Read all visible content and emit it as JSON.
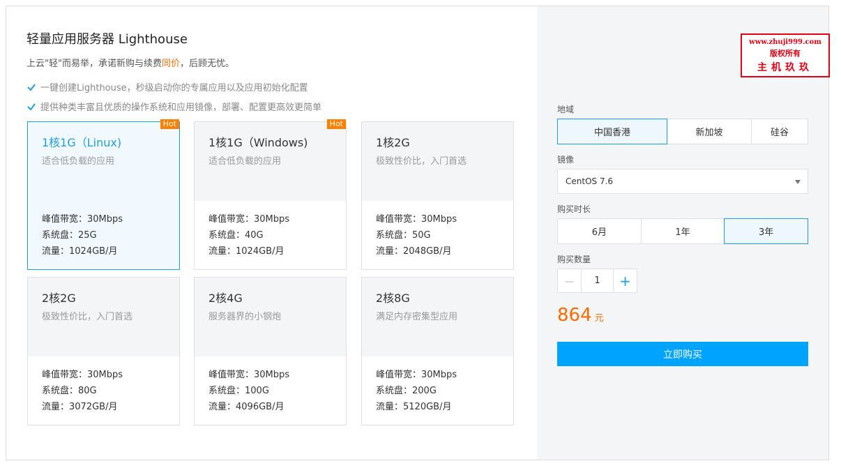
{
  "header": {
    "title": "轻量应用服务器 Lighthouse",
    "subtitle_prefix": "上云\"轻\"而易举，承诺新购与续费",
    "subtitle_highlight": "同价",
    "subtitle_suffix": "，后顾无忧。",
    "features": [
      "一键创建Lighthouse，秒级启动你的专属应用以及应用初始化配置",
      "提供种类丰富且优质的操作系统和应用镜像，部署、配置更高效更简单"
    ]
  },
  "plans": [
    {
      "name": "1核1G（Linux)",
      "desc": "适合低负载的应用",
      "hot": "Hot",
      "bandwidth": "峰值带宽：30Mbps",
      "disk": "系统盘：25G",
      "traffic": "流量：1024GB/月",
      "selected": true
    },
    {
      "name": "1核1G（Windows)",
      "desc": "适合低负载的应用",
      "hot": "Hot",
      "bandwidth": "峰值带宽：30Mbps",
      "disk": "系统盘：40G",
      "traffic": "流量：1024GB/月",
      "selected": false
    },
    {
      "name": "1核2G",
      "desc": "极致性价比，入门首选",
      "hot": "",
      "bandwidth": "峰值带宽：30Mbps",
      "disk": "系统盘：50G",
      "traffic": "流量：2048GB/月",
      "selected": false
    },
    {
      "name": "2核2G",
      "desc": "极致性价比，入门首选",
      "hot": "",
      "bandwidth": "峰值带宽：30Mbps",
      "disk": "系统盘：80G",
      "traffic": "流量：3072GB/月",
      "selected": false
    },
    {
      "name": "2核4G",
      "desc": "服务器界的小钢炮",
      "hot": "",
      "bandwidth": "峰值带宽：30Mbps",
      "disk": "系统盘：100G",
      "traffic": "流量：4096GB/月",
      "selected": false
    },
    {
      "name": "2核8G",
      "desc": "满足内存密集型应用",
      "hot": "",
      "bandwidth": "峰值带宽：30Mbps",
      "disk": "系统盘：200G",
      "traffic": "流量：5120GB/月",
      "selected": false
    }
  ],
  "order": {
    "region_label": "地域",
    "regions": [
      "中国香港",
      "新加坡",
      "硅谷"
    ],
    "image_label": "镜像",
    "image_value": "CentOS 7.6",
    "duration_label": "购买时长",
    "durations": [
      "6月",
      "1年",
      "3年"
    ],
    "quantity_label": "购买数量",
    "quantity_minus": "－",
    "quantity": "1",
    "quantity_plus": "+",
    "price": "864",
    "price_unit": "元",
    "buy_label": "立即购买"
  },
  "watermark": {
    "line1": "www.zhuji999.com",
    "line2": "版权所有",
    "line3": "主机玖玖"
  },
  "colors": {
    "accent": "#00a4ff",
    "selected_border": "#1aa0e0",
    "price": "#ff6a00",
    "hot_badge": "#ff7f00",
    "stamp": "#e60012"
  }
}
